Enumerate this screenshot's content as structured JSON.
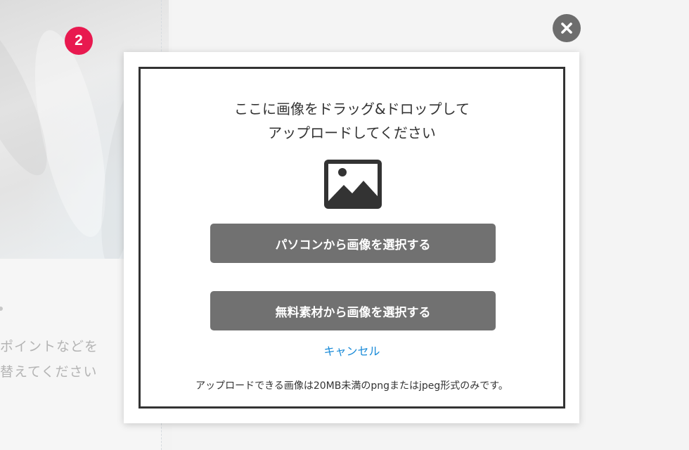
{
  "background": {
    "step_number": "2",
    "text_line1": "ポイントなどを",
    "text_line2": "替えてください"
  },
  "dialog": {
    "instruction_line1": "ここに画像をドラッグ&ドロップして",
    "instruction_line2": "アップロードしてください",
    "image_icon": "image-placeholder-icon",
    "pc_button_label": "パソコンから画像を選択する",
    "stock_button_label": "無料素材から画像を選択する",
    "cancel_label": "キャンセル",
    "note": "アップロードできる画像は20MB未満のpngまたはjpeg形式のみです。",
    "close_icon": "close-icon"
  },
  "colors": {
    "badge": "#e8194f",
    "button": "#717171",
    "link": "#1a8bd8",
    "border": "#333333"
  }
}
